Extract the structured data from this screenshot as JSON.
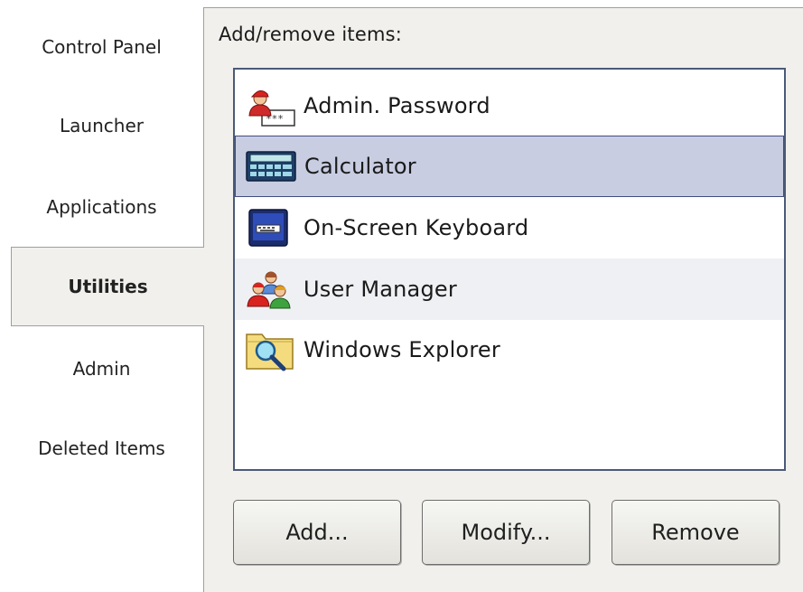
{
  "nav": {
    "items": [
      {
        "label": "Control Panel"
      },
      {
        "label": "Launcher"
      },
      {
        "label": "Applications"
      },
      {
        "label": "Utilities",
        "active": true
      },
      {
        "label": "Admin"
      },
      {
        "label": "Deleted Items"
      }
    ]
  },
  "panel": {
    "title": "Add/remove items:",
    "list": [
      {
        "label": "Admin. Password",
        "icon": "user-password-icon"
      },
      {
        "label": "Calculator",
        "icon": "calculator-icon",
        "selected": true
      },
      {
        "label": "On-Screen Keyboard",
        "icon": "keyboard-icon"
      },
      {
        "label": "User Manager",
        "icon": "users-icon"
      },
      {
        "label": "Windows Explorer",
        "icon": "folder-search-icon"
      }
    ],
    "buttons": {
      "add": "Add...",
      "modify": "Modify...",
      "remove": "Remove"
    }
  },
  "colors": {
    "panel_bg": "#f1f0ec",
    "selected_bg": "#c8cde2",
    "selected_border": "#424d7d",
    "list_border": "#4a5a78"
  }
}
